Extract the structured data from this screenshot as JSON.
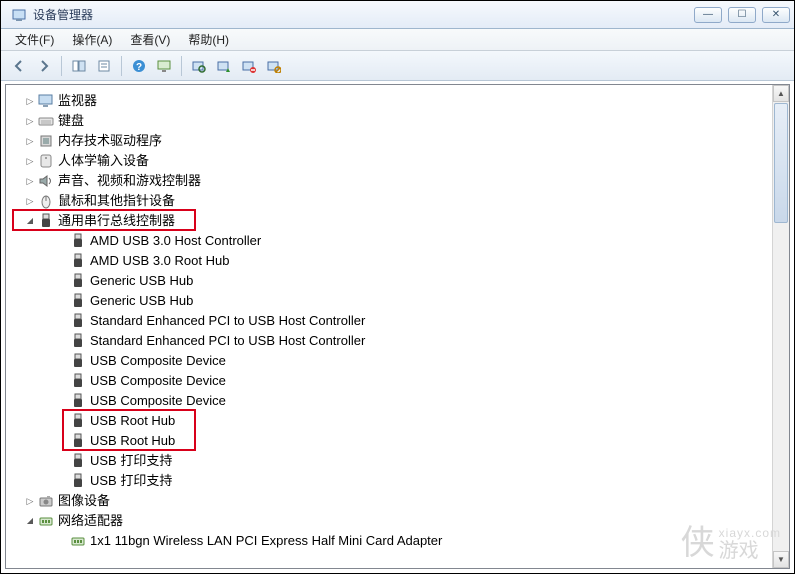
{
  "window": {
    "title": "设备管理器"
  },
  "menus": {
    "file": "文件(F)",
    "action": "操作(A)",
    "view": "查看(V)",
    "help": "帮助(H)"
  },
  "toolbar_icons": [
    "back",
    "forward",
    "sep",
    "show-hide",
    "sep",
    "help",
    "monitor",
    "sep",
    "scan",
    "update",
    "uninstall",
    "disable"
  ],
  "tree": [
    {
      "lvl": 1,
      "arrow": "closed",
      "icon": "monitor",
      "label": "监视器"
    },
    {
      "lvl": 1,
      "arrow": "closed",
      "icon": "keyboard",
      "label": "键盘"
    },
    {
      "lvl": 1,
      "arrow": "closed",
      "icon": "chip",
      "label": "内存技术驱动程序"
    },
    {
      "lvl": 1,
      "arrow": "closed",
      "icon": "hid",
      "label": "人体学输入设备"
    },
    {
      "lvl": 1,
      "arrow": "closed",
      "icon": "sound",
      "label": "声音、视频和游戏控制器"
    },
    {
      "lvl": 1,
      "arrow": "closed",
      "icon": "mouse",
      "label": "鼠标和其他指针设备"
    },
    {
      "lvl": 1,
      "arrow": "open",
      "icon": "usb",
      "label": "通用串行总线控制器",
      "hl": "cat"
    },
    {
      "lvl": 2,
      "arrow": "",
      "icon": "usb",
      "label": "AMD USB 3.0 Host Controller"
    },
    {
      "lvl": 2,
      "arrow": "",
      "icon": "usb",
      "label": "AMD USB 3.0 Root Hub"
    },
    {
      "lvl": 2,
      "arrow": "",
      "icon": "usb",
      "label": "Generic USB Hub"
    },
    {
      "lvl": 2,
      "arrow": "",
      "icon": "usb",
      "label": "Generic USB Hub"
    },
    {
      "lvl": 2,
      "arrow": "",
      "icon": "usb",
      "label": "Standard Enhanced PCI to USB Host Controller"
    },
    {
      "lvl": 2,
      "arrow": "",
      "icon": "usb",
      "label": "Standard Enhanced PCI to USB Host Controller"
    },
    {
      "lvl": 2,
      "arrow": "",
      "icon": "usb",
      "label": "USB Composite Device"
    },
    {
      "lvl": 2,
      "arrow": "",
      "icon": "usb",
      "label": "USB Composite Device"
    },
    {
      "lvl": 2,
      "arrow": "",
      "icon": "usb",
      "label": "USB Composite Device"
    },
    {
      "lvl": 2,
      "arrow": "",
      "icon": "usb",
      "label": "USB Root Hub",
      "hl": "sub-start"
    },
    {
      "lvl": 2,
      "arrow": "",
      "icon": "usb",
      "label": "USB Root Hub",
      "hl": "sub-end"
    },
    {
      "lvl": 2,
      "arrow": "",
      "icon": "usb",
      "label": "USB 打印支持"
    },
    {
      "lvl": 2,
      "arrow": "",
      "icon": "usb",
      "label": "USB 打印支持"
    },
    {
      "lvl": 1,
      "arrow": "closed",
      "icon": "camera",
      "label": "图像设备"
    },
    {
      "lvl": 1,
      "arrow": "open",
      "icon": "net",
      "label": "网络适配器"
    },
    {
      "lvl": 2,
      "arrow": "",
      "icon": "net",
      "label": "1x1 11bgn Wireless LAN PCI Express Half Mini Card Adapter"
    }
  ],
  "watermark": {
    "line1": "侠",
    "line2": "xiayx.com",
    "line3": "游戏"
  }
}
